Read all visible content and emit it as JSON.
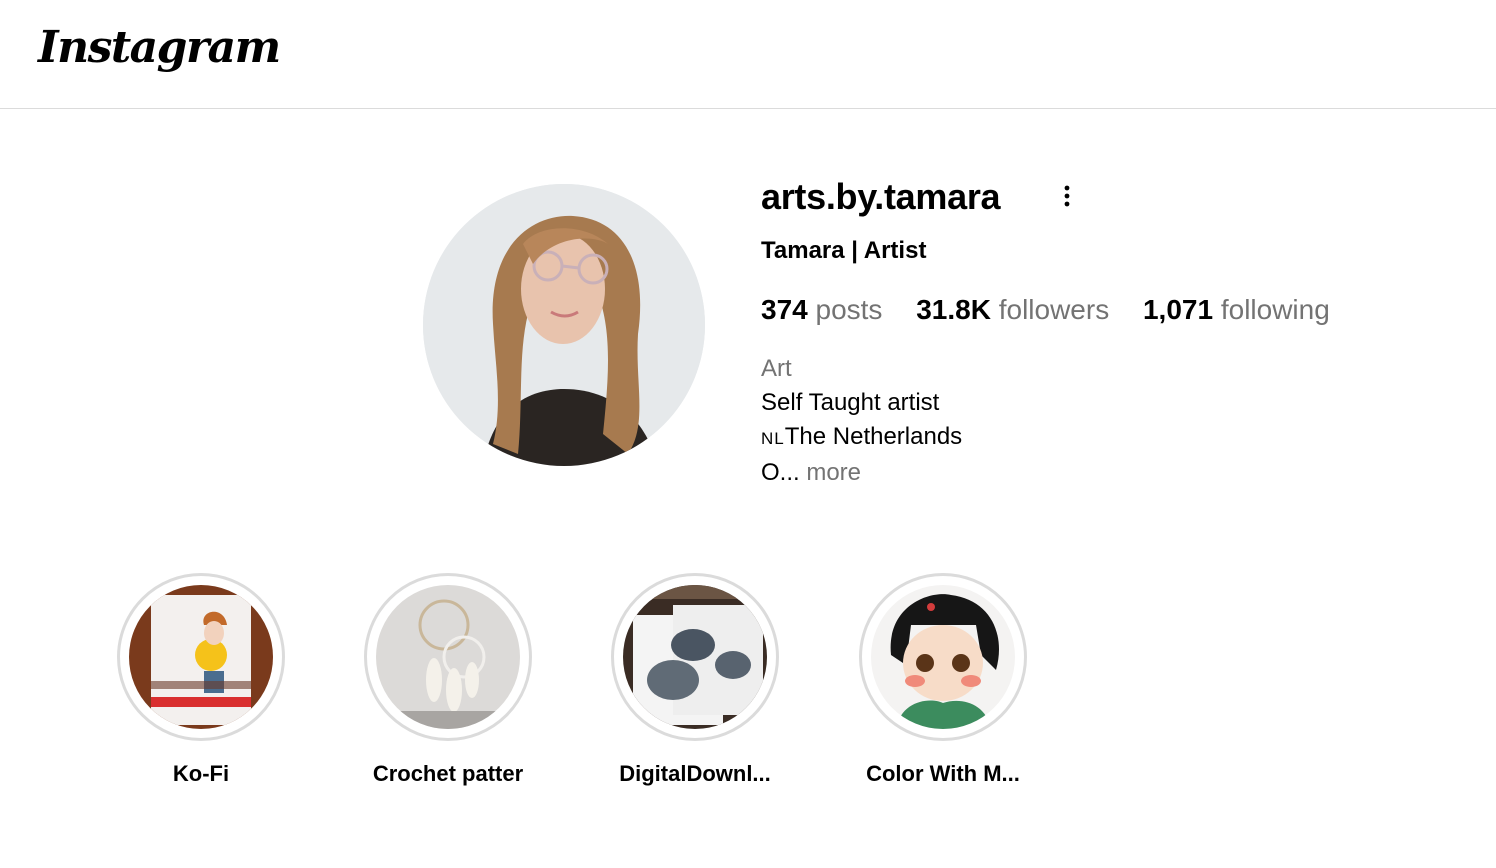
{
  "header": {
    "logo_text": "Instagram"
  },
  "profile": {
    "username": "arts.by.tamara",
    "full_name": "Tamara | Artist",
    "stats": {
      "posts_count": "374",
      "posts_label": "posts",
      "followers_count": "31.8K",
      "followers_label": "followers",
      "following_count": "1,071",
      "following_label": "following"
    },
    "bio": {
      "category": "Art",
      "line1": "Self Taught artist",
      "flag": "NL",
      "line2": "The Netherlands",
      "line3": "O...",
      "more_label": "more"
    }
  },
  "highlights": [
    {
      "label": "Ko-Fi"
    },
    {
      "label": "Crochet patter"
    },
    {
      "label": "DigitalDownl..."
    },
    {
      "label": "Color With M..."
    }
  ],
  "colors": {
    "secondary_text": "#737373",
    "border": "#dbdbdb"
  }
}
